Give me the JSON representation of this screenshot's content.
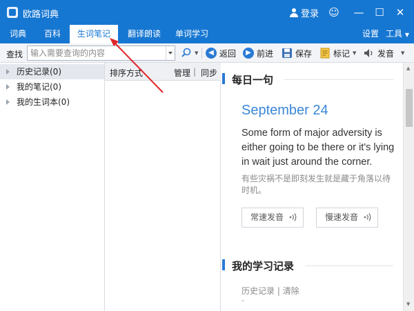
{
  "window": {
    "title": "欧路词典",
    "login_label": "登录",
    "controls": [
      "☺",
      "—",
      "☐",
      "✕"
    ]
  },
  "tabs": {
    "items": [
      "词典",
      "百科",
      "生词笔记",
      "翻译朗读",
      "单词学习"
    ],
    "active": "生词笔记",
    "settings_label": "设置",
    "tools_label": "工具"
  },
  "toolbar": {
    "search_label": "查找",
    "search_placeholder": "输入需要查询的内容",
    "back_label": "返回",
    "forward_label": "前进",
    "save_label": "保存",
    "tag_label": "标记",
    "speak_label": "发音"
  },
  "sidebar": {
    "items": [
      {
        "label": "历史记录(0)",
        "selected": true
      },
      {
        "label": "我的笔记(0)",
        "selected": false
      },
      {
        "label": "我的生词本(0)",
        "selected": false
      }
    ]
  },
  "list": {
    "sort_label": "排序方式",
    "manage_label": "管理",
    "divider": "|",
    "sync_label": "同步"
  },
  "daily": {
    "section_title": "每日一句",
    "date": "September 24",
    "english": "Some form of major adversity is either going to be there or it's lying in wait just around the corner.",
    "chinese": "有些灾祸不是即刻发生就是藏于角落以待时机。",
    "normal_speed_label": "常速发音",
    "slow_speed_label": "慢速发音"
  },
  "study": {
    "section_title": "我的学习记录",
    "history_link": "历史记录",
    "divider": "|",
    "clear_link": "清除",
    "dash": "-"
  },
  "colors": {
    "brand": "#1677d2",
    "accent": "#3a86d8",
    "arrow": "#e0252b"
  }
}
